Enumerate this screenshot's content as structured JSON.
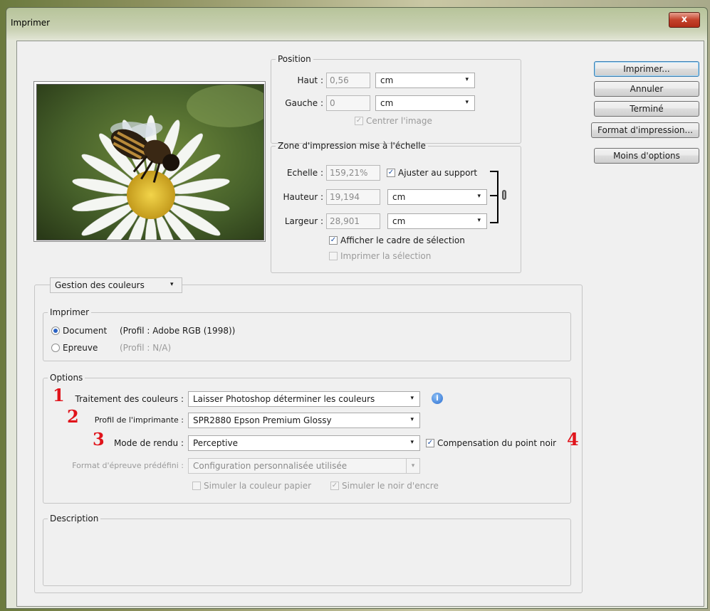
{
  "window": {
    "title": "Imprimer",
    "close_glyph": "x"
  },
  "position": {
    "legend": "Position",
    "haut_label": "Haut :",
    "haut_value": "0,56",
    "haut_unit": "cm",
    "gauche_label": "Gauche :",
    "gauche_value": "0",
    "gauche_unit": "cm",
    "center_label": "Centrer l'image"
  },
  "scaled": {
    "legend": "Zone d'impression mise à l'échelle",
    "echelle_label": "Echelle :",
    "echelle_value": "159,21%",
    "fit_label": "Ajuster au support",
    "hauteur_label": "Hauteur :",
    "hauteur_value": "19,194",
    "hauteur_unit": "cm",
    "largeur_label": "Largeur :",
    "largeur_value": "28,901",
    "largeur_unit": "cm",
    "bbox_label": "Afficher le cadre de sélection",
    "print_sel_label": "Imprimer la sélection"
  },
  "buttons": {
    "print": "Imprimer...",
    "cancel": "Annuler",
    "done": "Terminé",
    "page_setup": "Format d'impression...",
    "fewer": "Moins d'options"
  },
  "color": {
    "section_select": "Gestion des couleurs",
    "print_legend": "Imprimer",
    "document_label": "Document",
    "document_profile": "(Profil : Adobe RGB (1998))",
    "proof_label": "Epreuve",
    "proof_profile": "(Profil : N/A)",
    "options_legend": "Options",
    "handling_label": "Traitement des couleurs :",
    "handling_value": "Laisser Photoshop déterminer les couleurs",
    "profile_label": "Profil de l'imprimante :",
    "profile_value": "SPR2880 Epson Premium Glossy",
    "intent_label": "Mode de rendu :",
    "intent_value": "Perceptive",
    "bpc_label": "Compensation du point noir",
    "proof_setup_label": "Format d'épreuve prédéfini :",
    "proof_setup_value": "Configuration personnalisée utilisée",
    "sim_paper_label": "Simuler la couleur papier",
    "sim_ink_label": "Simuler le noir d'encre",
    "description_legend": "Description"
  },
  "annotations": [
    "1",
    "2",
    "3",
    "4"
  ],
  "icons": {
    "dropdown": "▾",
    "check": "✓",
    "info": "i"
  }
}
